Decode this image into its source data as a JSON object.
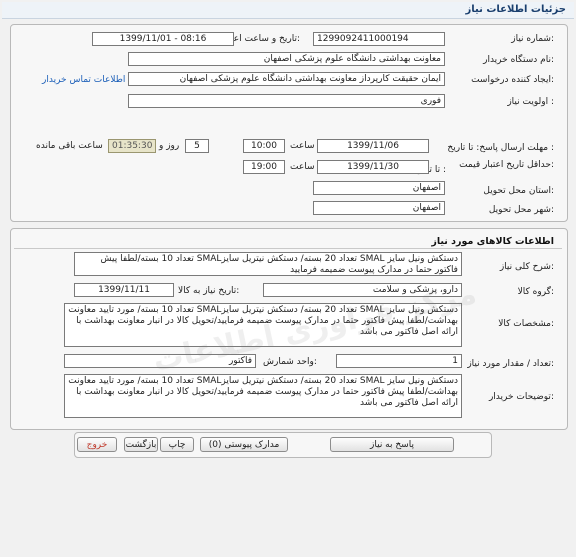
{
  "header": {
    "title": "جزئیات اطلاعات نیاز"
  },
  "info": {
    "need_number_label": "شماره نیاز:",
    "need_number": "1299092411000194",
    "announce_label": "تاریخ و ساعت اعلان عمومی:",
    "announce_value": "1399/11/01 - 08:16",
    "buyer_label": "نام دستگاه خریدار:",
    "buyer_value": "معاونت بهداشتی دانشگاه علوم پزشکی اصفهان",
    "creator_label": "ایجاد کننده درخواست:",
    "creator_value": "ایمان حقیقت کارپرداز معاونت بهداشتی دانشگاه علوم پزشکی اصفهان",
    "contact_link": "اطلاعات تماس خریدار",
    "priority_label": "اولویت نیاز :",
    "priority_value": "فوری",
    "deadline_label": "مهلت ارسال پاسخ: تا تاریخ :",
    "deadline_date": "1399/11/06",
    "deadline_time_label": "ساعت",
    "deadline_time": "10:00",
    "remain_days": "5",
    "remain_days_label": "روز و",
    "remain_time": "01:35:30",
    "remain_label": "ساعت باقی مانده",
    "validity_label": "حداقل تاریخ اعتبار قیمت:",
    "validity_to_label": "تا تاریخ :",
    "validity_date": "1399/11/30",
    "validity_time_label": "ساعت",
    "validity_time": "19:00",
    "province_label": "استان محل تحویل:",
    "province_value": "اصفهان",
    "city_label": "شهر محل تحویل:",
    "city_value": "اصفهان"
  },
  "goods": {
    "section_title": "اطلاعات کالاهای مورد نیاز",
    "summary_label": "شرح کلی نیاز:",
    "summary_value": "دستکش ونیل سایز SMAL تعداد 20 بسته/ دستکش نیتریل سایزSMAL تعداد 10 بسته/لطفا پیش فاکتور حتما در مدارک پیوست ضمیمه فرمایید",
    "group_label": "گروه کالا:",
    "group_value": "دارو، پزشکی و سلامت",
    "need_date_label": "تاریخ نیاز به کالا:",
    "need_date_value": "1399/11/11",
    "spec_label": "مشخصات کالا:",
    "spec_value": "دستکش ونیل سایز SMAL تعداد 20 بسته/ دستکش نیتریل سایزSMAL تعداد 10 بسته/ مورد تایید معاونت بهداشت/لطفا پیش فاکتور حتما در مدارک پیوست ضمیمه فرمایید/تحویل کالا در انبار معاونت بهداشت با ارائه اصل فاکتور می باشد",
    "qty_label": "تعداد / مقدار مورد نیاز:",
    "qty_value": "1",
    "unit_label": "واحد شمارش:",
    "unit_value": "فاکتور",
    "desc_label": "توضیحات خریدار:",
    "desc_value": "دستکش ونیل سایز SMAL تعداد 20 بسته/ دستکش نیتریل سایزSMAL تعداد 10 بسته/ مورد تایید معاونت بهداشت/لطفا پیش فاکتور حتما در مدارک پیوست ضمیمه فرمایید/تحویل کالا در انبار معاونت بهداشت با ارائه اصل فاکتور می باشد"
  },
  "buttons": {
    "respond": "پاسخ به نیاز",
    "attachments": "مدارک پیوستی (0)",
    "print": "چاپ",
    "back": "بازگشت",
    "exit": "خروج"
  },
  "colors": {
    "exit_text": "#c0392b",
    "link": "#1a5eb8",
    "remain_bg": "#e7e4c9"
  }
}
